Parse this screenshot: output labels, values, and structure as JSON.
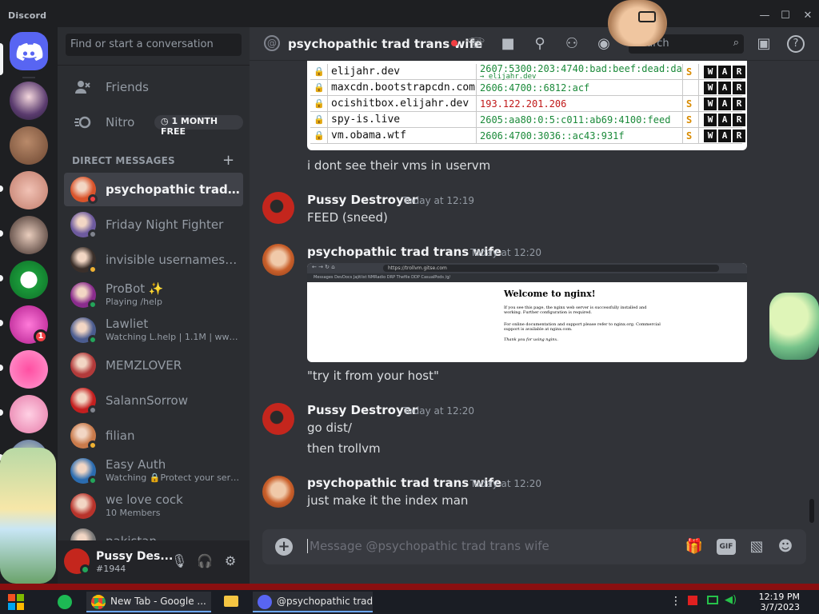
{
  "app": {
    "title": "Discord"
  },
  "window_controls": {
    "minimize": "—",
    "maximize": "☐",
    "close": "✕"
  },
  "dm_sidebar": {
    "search_placeholder": "Find or start a conversation",
    "friends_label": "Friends",
    "nitro_label": "Nitro",
    "nitro_badge": "1 MONTH FREE",
    "section_header": "DIRECT MESSAGES",
    "add_dm": "+",
    "dms": [
      {
        "name": "psychopathic trad tra...",
        "sub": "",
        "status": "dnd",
        "color": "#d9542b",
        "active": true
      },
      {
        "name": "Friday Night Fighter",
        "sub": "",
        "status": "offline",
        "color": "#6d5a9e",
        "active": false
      },
      {
        "name": "invisible usernames ar...",
        "sub": "",
        "status": "idle",
        "color": "#3a2f2a",
        "active": false
      },
      {
        "name": "ProBot ✨",
        "sub": "Playing /help",
        "status": "online",
        "color": "#8a2c8d",
        "active": false
      },
      {
        "name": "Lawliet",
        "sub": "Watching L.help | 1.1M | www.l...",
        "status": "online",
        "color": "#4b5c8f",
        "active": false
      },
      {
        "name": "MEMZLOVER",
        "sub": "",
        "status": "none",
        "color": "#b23a3a",
        "active": false
      },
      {
        "name": "SalannSorrow",
        "sub": "",
        "status": "offline",
        "color": "#c41f1f",
        "active": false
      },
      {
        "name": "filian",
        "sub": "",
        "status": "idle",
        "color": "#c97a4b",
        "active": false
      },
      {
        "name": "Easy Auth",
        "sub": "Watching 🔒Protect your serv...",
        "status": "online",
        "color": "#2b6cb0",
        "active": false
      },
      {
        "name": "we love cock",
        "sub": "10 Members",
        "status": "none",
        "color": "#b8332b",
        "active": false
      },
      {
        "name": "pakistan",
        "sub": "",
        "status": "none",
        "color": "#777777",
        "active": false
      }
    ]
  },
  "user_panel": {
    "name": "Pussy Des...",
    "tag": "#1944",
    "mic_icon": "🎙",
    "headset_icon": "🎧",
    "settings_icon": "⚙"
  },
  "chat": {
    "channel_name": "psychopathic trad trans wife",
    "header_search_placeholder": "Search",
    "messages": [
      {
        "author": "",
        "time": "",
        "lines": [
          "i dont see their vms in uservm"
        ]
      },
      {
        "author": "Pussy Destroyer",
        "time": "Today at 12:19",
        "lines": [
          "FEED (sneed)"
        ]
      },
      {
        "author": "psychopathic trad trans wife",
        "time": "Today at 12:20",
        "lines": [
          "\"try it from your host\""
        ]
      },
      {
        "author": "Pussy Destroyer",
        "time": "Today at 12:20",
        "lines": [
          "go dist/",
          "then trollvm"
        ]
      },
      {
        "author": "psychopathic trad trans wife",
        "time": "Today at 12:20",
        "lines": [
          "just make it the index man"
        ]
      }
    ],
    "table_rows": [
      {
        "host": "elijahr.dev",
        "ip": "2607:5300:203:4740:bad:beef:dead:dad",
        "ip_sub": "→ elijahr.dev",
        "ip_type": "v6",
        "s": "S",
        "flags": [
          "W",
          "A",
          "R"
        ]
      },
      {
        "host": "maxcdn.bootstrapcdn.com",
        "ip": "2606:4700::6812:acf",
        "ip_sub": "",
        "ip_type": "v6",
        "s": "",
        "flags": [
          "W",
          "A",
          "R"
        ]
      },
      {
        "host": "ocishitbox.elijahr.dev",
        "ip": "193.122.201.206",
        "ip_sub": "",
        "ip_type": "v4",
        "s": "S",
        "flags": [
          "W",
          "A",
          "R"
        ]
      },
      {
        "host": "spy-is.live",
        "ip": "2605:aa80:0:5:c011:ab69:4100:feed",
        "ip_sub": "",
        "ip_type": "v6",
        "s": "S",
        "flags": [
          "W",
          "A",
          "R"
        ]
      },
      {
        "host": "vm.obama.wtf",
        "ip": "2606:4700:3036::ac43:931f",
        "ip_sub": "",
        "ip_type": "v6",
        "s": "S",
        "flags": [
          "W",
          "A",
          "R"
        ]
      }
    ],
    "nginx_embed": {
      "url": "https://trollvm.gitse.com",
      "bookmarks": "Messages   DevDocs   Jajitlist   NMRadio   DRP   Thefile   DDP   CasualPods   /g/",
      "title": "Welcome to nginx!",
      "p1": "If you see this page, the nginx web server is successfully installed and working. Further configuration is required.",
      "p2": "For online documentation and support please refer to nginx.org. Commercial support is available at nginx.com.",
      "p3": "Thank you for using nginx."
    }
  },
  "composer": {
    "placeholder": "Message @psychopathic trad trans wife",
    "gif_label": "GIF"
  },
  "taskbar": {
    "tasks": [
      {
        "label": "New Tab - Google ...",
        "color": "#4285f4"
      },
      {
        "label": "@psychopathic trad...",
        "color": "#5865f2"
      }
    ],
    "clock_time": "12:19 PM",
    "clock_date": "3/7/2023"
  },
  "colors": {
    "brand": "#5865f2",
    "online": "#23a55a",
    "idle": "#f0b232",
    "dnd": "#f23f43",
    "offline": "#80848e",
    "mention": "#f23f43"
  }
}
